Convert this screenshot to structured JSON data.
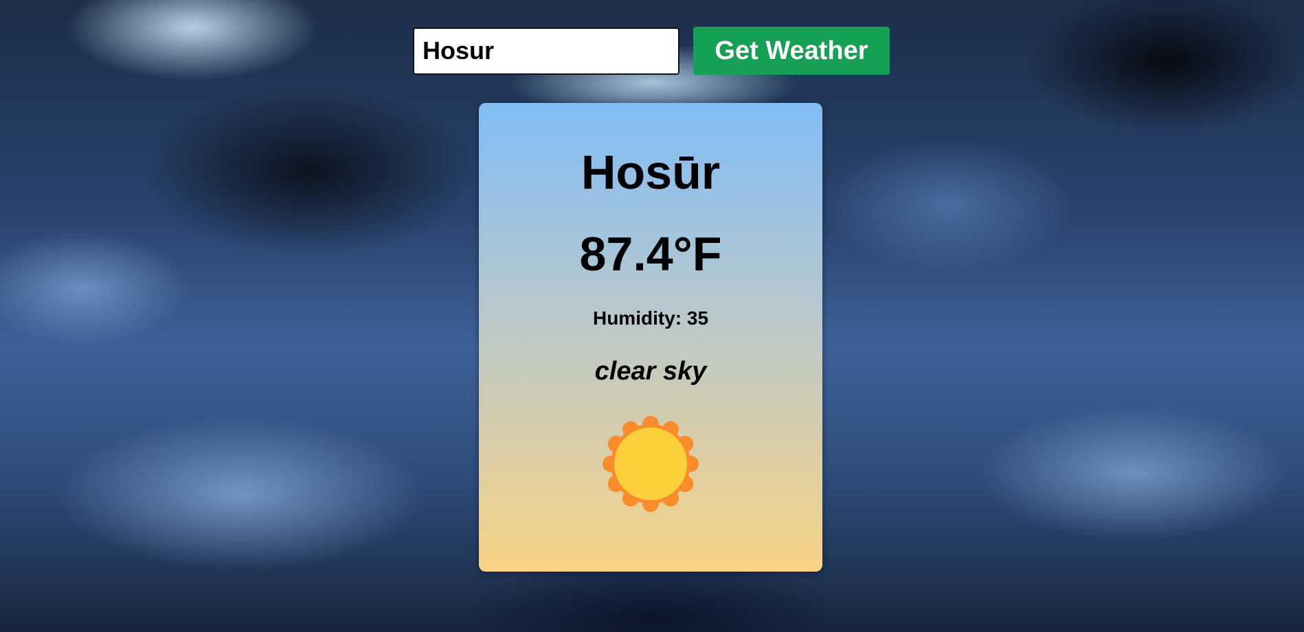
{
  "search": {
    "city_value": "Hosur",
    "button_label": "Get Weather"
  },
  "weather": {
    "city": "Hosūr",
    "temperature": "87.4°F",
    "humidity": "Humidity: 35",
    "description": "clear sky",
    "icon": "sun-icon"
  },
  "colors": {
    "button": "#16a055",
    "card_top": "#80bdf6",
    "card_bottom": "#f9d385",
    "sun_outer": "#fb8c2c",
    "sun_inner": "#fdd03b"
  }
}
